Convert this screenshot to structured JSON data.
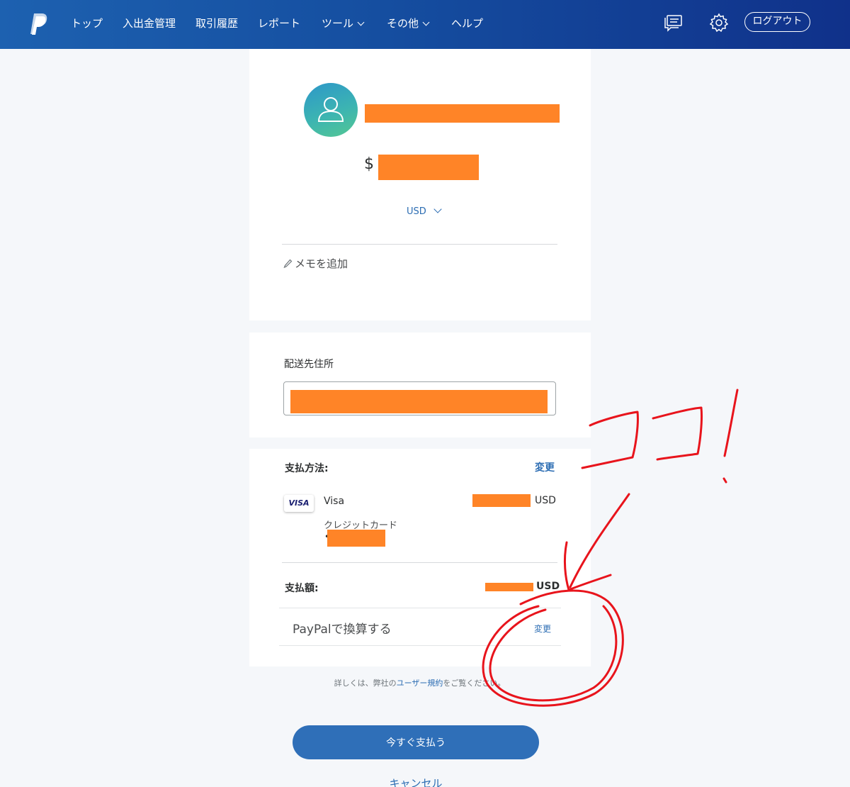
{
  "nav": {
    "items": [
      {
        "label": "トップ",
        "has_dropdown": false
      },
      {
        "label": "入出金管理",
        "has_dropdown": false
      },
      {
        "label": "取引履歴",
        "has_dropdown": false
      },
      {
        "label": "レポート",
        "has_dropdown": false
      },
      {
        "label": "ツール",
        "has_dropdown": true
      },
      {
        "label": "その他",
        "has_dropdown": true
      },
      {
        "label": "ヘルプ",
        "has_dropdown": false
      }
    ],
    "logout_label": "ログアウト"
  },
  "recipient": {
    "currency_symbol": "$",
    "currency": "USD",
    "memo_label": "メモを追加"
  },
  "shipping": {
    "label": "配送先住所"
  },
  "payment": {
    "method_label": "支払方法:",
    "change_label": "変更",
    "card_brand_badge": "VISA",
    "card_name": "Visa",
    "card_type": "クレジットカード",
    "card_prefix": "•",
    "amount_currency": "USD",
    "total_label": "支払額:",
    "total_currency": "USD",
    "conversion_label": "PayPalで換算する",
    "conversion_change_label": "変更"
  },
  "terms": {
    "prefix": "詳しくは、弊社の",
    "link": "ユーザー規約",
    "suffix": "をご覧ください。"
  },
  "actions": {
    "pay_now": "今すぐ支払う",
    "cancel": "キャンセル"
  },
  "annotation": {
    "text": "ココ!",
    "color": "#e8141c"
  },
  "colors": {
    "nav_bg": "#1d61b0",
    "accent": "#2c6db3",
    "pay_button": "#2f6fb8",
    "redaction": "#ff8427",
    "page_bg": "#f5f7fa"
  }
}
